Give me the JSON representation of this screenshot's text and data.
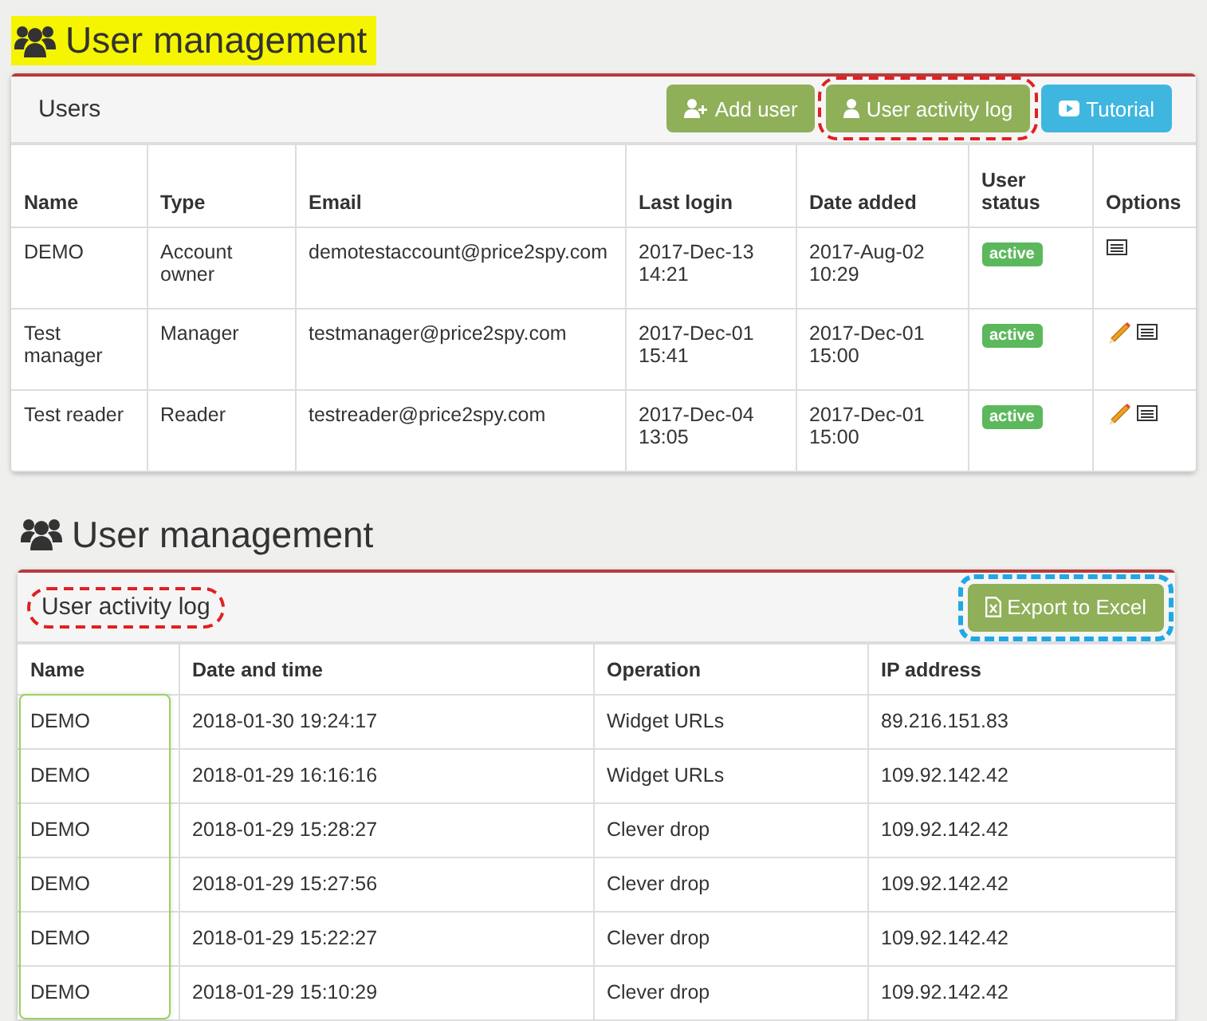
{
  "users_section": {
    "title": "User management",
    "title_highlighted": true,
    "panel": {
      "title": "Users",
      "buttons": [
        {
          "kind": "add",
          "label": "Add user",
          "circled": false
        },
        {
          "kind": "activity",
          "label": "User activity log",
          "circled": true
        },
        {
          "kind": "tutorial",
          "label": "Tutorial",
          "circled": false
        }
      ],
      "columns": [
        "Name",
        "Type",
        "Email",
        "Last login",
        "Date added",
        "User status",
        "Options"
      ],
      "rows": [
        {
          "name": "DEMO",
          "type": "Account owner",
          "email": "demotestaccount@price2spy.com",
          "last_login": "2017-Dec-13 14:21",
          "date_added": "2017-Aug-02 10:29",
          "status": "active",
          "can_edit": false
        },
        {
          "name": "Test manager",
          "type": "Manager",
          "email": "testmanager@price2spy.com",
          "last_login": "2017-Dec-01 15:41",
          "date_added": "2017-Dec-01 15:00",
          "status": "active",
          "can_edit": true
        },
        {
          "name": "Test reader",
          "type": "Reader",
          "email": "testreader@price2spy.com",
          "last_login": "2017-Dec-04 13:05",
          "date_added": "2017-Dec-01 15:00",
          "status": "active",
          "can_edit": true
        }
      ]
    }
  },
  "activity_section": {
    "title": "User management",
    "panel": {
      "title": "User activity log",
      "title_circled": true,
      "export_button": {
        "label": "Export to Excel",
        "circled": true
      },
      "columns": [
        "Name",
        "Date and time",
        "Operation",
        "IP address"
      ],
      "name_column_outlined": true,
      "rows": [
        {
          "name": "DEMO",
          "date_time": "2018-01-30 19:24:17",
          "operation": "Widget URLs",
          "ip": "89.216.151.83"
        },
        {
          "name": "DEMO",
          "date_time": "2018-01-29 16:16:16",
          "operation": "Widget URLs",
          "ip": "109.92.142.42"
        },
        {
          "name": "DEMO",
          "date_time": "2018-01-29 15:28:27",
          "operation": "Clever drop",
          "ip": "109.92.142.42"
        },
        {
          "name": "DEMO",
          "date_time": "2018-01-29 15:27:56",
          "operation": "Clever drop",
          "ip": "109.92.142.42"
        },
        {
          "name": "DEMO",
          "date_time": "2018-01-29 15:22:27",
          "operation": "Clever drop",
          "ip": "109.92.142.42"
        },
        {
          "name": "DEMO",
          "date_time": "2018-01-29 15:10:29",
          "operation": "Clever drop",
          "ip": "109.92.142.42"
        }
      ]
    }
  }
}
